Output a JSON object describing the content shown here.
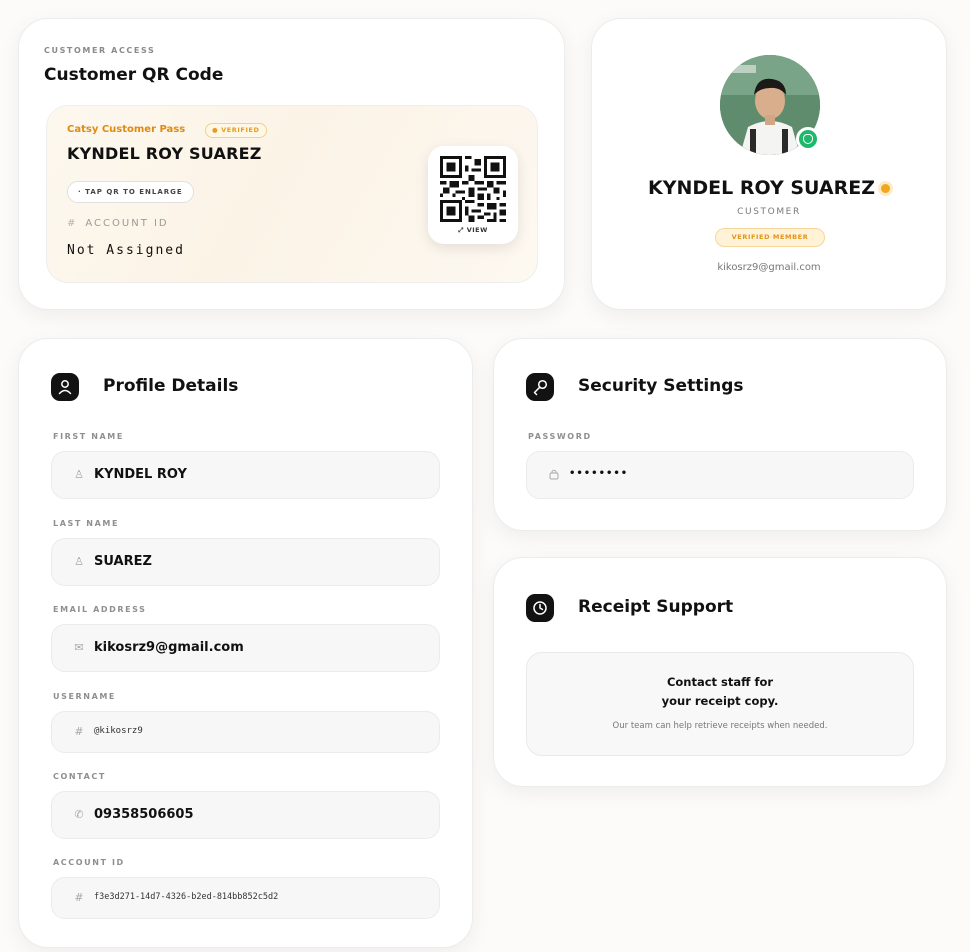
{
  "qr_card": {
    "eyebrow": "CUSTOMER ACCESS",
    "title": "Customer QR Code",
    "pass": {
      "name": "Catsy Customer Pass",
      "badge": "● VERIFIED",
      "holder": "KYNDEL ROY SUAREZ",
      "tap_hint": "· TAP QR TO ENLARGE",
      "account_id_label": "ACCOUNT ID",
      "account_id_value": "Not Assigned",
      "view_label": "⤢ VIEW"
    }
  },
  "profile": {
    "avatar": "profile-photo",
    "name": "KYNDEL ROY SUAREZ",
    "role": "CUSTOMER",
    "badge": "VERIFIED MEMBER",
    "email": "kikosrz9@gmail.com",
    "status_color": "#1fb86a",
    "accent_color": "#f2a81d"
  },
  "details": {
    "title": "Profile Details",
    "fields": [
      {
        "label": "FIRST NAME",
        "value": "KYNDEL ROY",
        "icon": "user-icon"
      },
      {
        "label": "LAST NAME",
        "value": "SUAREZ",
        "icon": "user-icon"
      },
      {
        "label": "EMAIL ADDRESS",
        "value": "kikosrz9@gmail.com",
        "icon": "mail-icon"
      },
      {
        "label": "USERNAME",
        "value": "@kikosrz9",
        "icon": "hash-icon"
      },
      {
        "label": "CONTACT",
        "value": "09358506605",
        "icon": "phone-icon"
      },
      {
        "label": "ACCOUNT ID",
        "value": "f3e3d271-14d7-4326-b2ed-814bb852c5d2",
        "icon": "hash-icon"
      }
    ]
  },
  "security": {
    "title": "Security Settings",
    "password_label": "PASSWORD",
    "password_value": "••••••••"
  },
  "receipt": {
    "title": "Receipt Support",
    "line1": "Contact staff for",
    "line2": "your receipt copy.",
    "note": "Our team can help retrieve receipts when needed."
  }
}
